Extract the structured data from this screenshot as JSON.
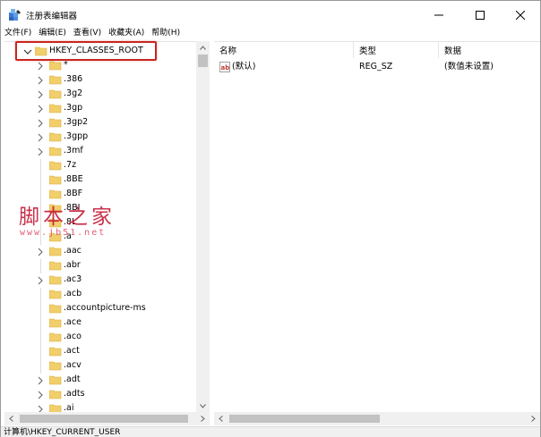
{
  "window": {
    "title": "注册表编辑器",
    "icon": "regedit-icon"
  },
  "menu": [
    "文件(F)",
    "编辑(E)",
    "查看(V)",
    "收藏夹(A)",
    "帮助(H)"
  ],
  "tree": {
    "root": "HKEY_CLASSES_ROOT",
    "items": [
      {
        "label": "*",
        "expandable": true
      },
      {
        "label": ".386",
        "expandable": true
      },
      {
        "label": ".3g2",
        "expandable": true
      },
      {
        "label": ".3gp",
        "expandable": true
      },
      {
        "label": ".3gp2",
        "expandable": true
      },
      {
        "label": ".3gpp",
        "expandable": true
      },
      {
        "label": ".3mf",
        "expandable": true
      },
      {
        "label": ".7z",
        "expandable": false
      },
      {
        "label": ".8BE",
        "expandable": false
      },
      {
        "label": ".8BF",
        "expandable": false
      },
      {
        "label": ".8BI",
        "expandable": false
      },
      {
        "label": ".8L",
        "expandable": false
      },
      {
        "label": ".a",
        "expandable": false
      },
      {
        "label": ".aac",
        "expandable": true
      },
      {
        "label": ".abr",
        "expandable": false
      },
      {
        "label": ".ac3",
        "expandable": true
      },
      {
        "label": ".acb",
        "expandable": false
      },
      {
        "label": ".accountpicture-ms",
        "expandable": false
      },
      {
        "label": ".ace",
        "expandable": false
      },
      {
        "label": ".aco",
        "expandable": false
      },
      {
        "label": ".act",
        "expandable": false
      },
      {
        "label": ".acv",
        "expandable": false
      },
      {
        "label": ".adt",
        "expandable": true
      },
      {
        "label": ".adts",
        "expandable": true
      },
      {
        "label": ".ai",
        "expandable": true
      }
    ]
  },
  "list": {
    "headers": {
      "name": "名称",
      "type": "类型",
      "data": "数据"
    },
    "rows": [
      {
        "name": "(默认)",
        "type": "REG_SZ",
        "data": "(数值未设置)"
      }
    ]
  },
  "status": "计算机\\HKEY_CURRENT_USER",
  "watermark": {
    "main": "脚本之家",
    "sub": "www.jb51.net"
  },
  "colors": {
    "folder": "#f1cf6a",
    "folder_dark": "#d9ac3b",
    "highlight": "#c8261f",
    "watermark": "#c4203b"
  }
}
